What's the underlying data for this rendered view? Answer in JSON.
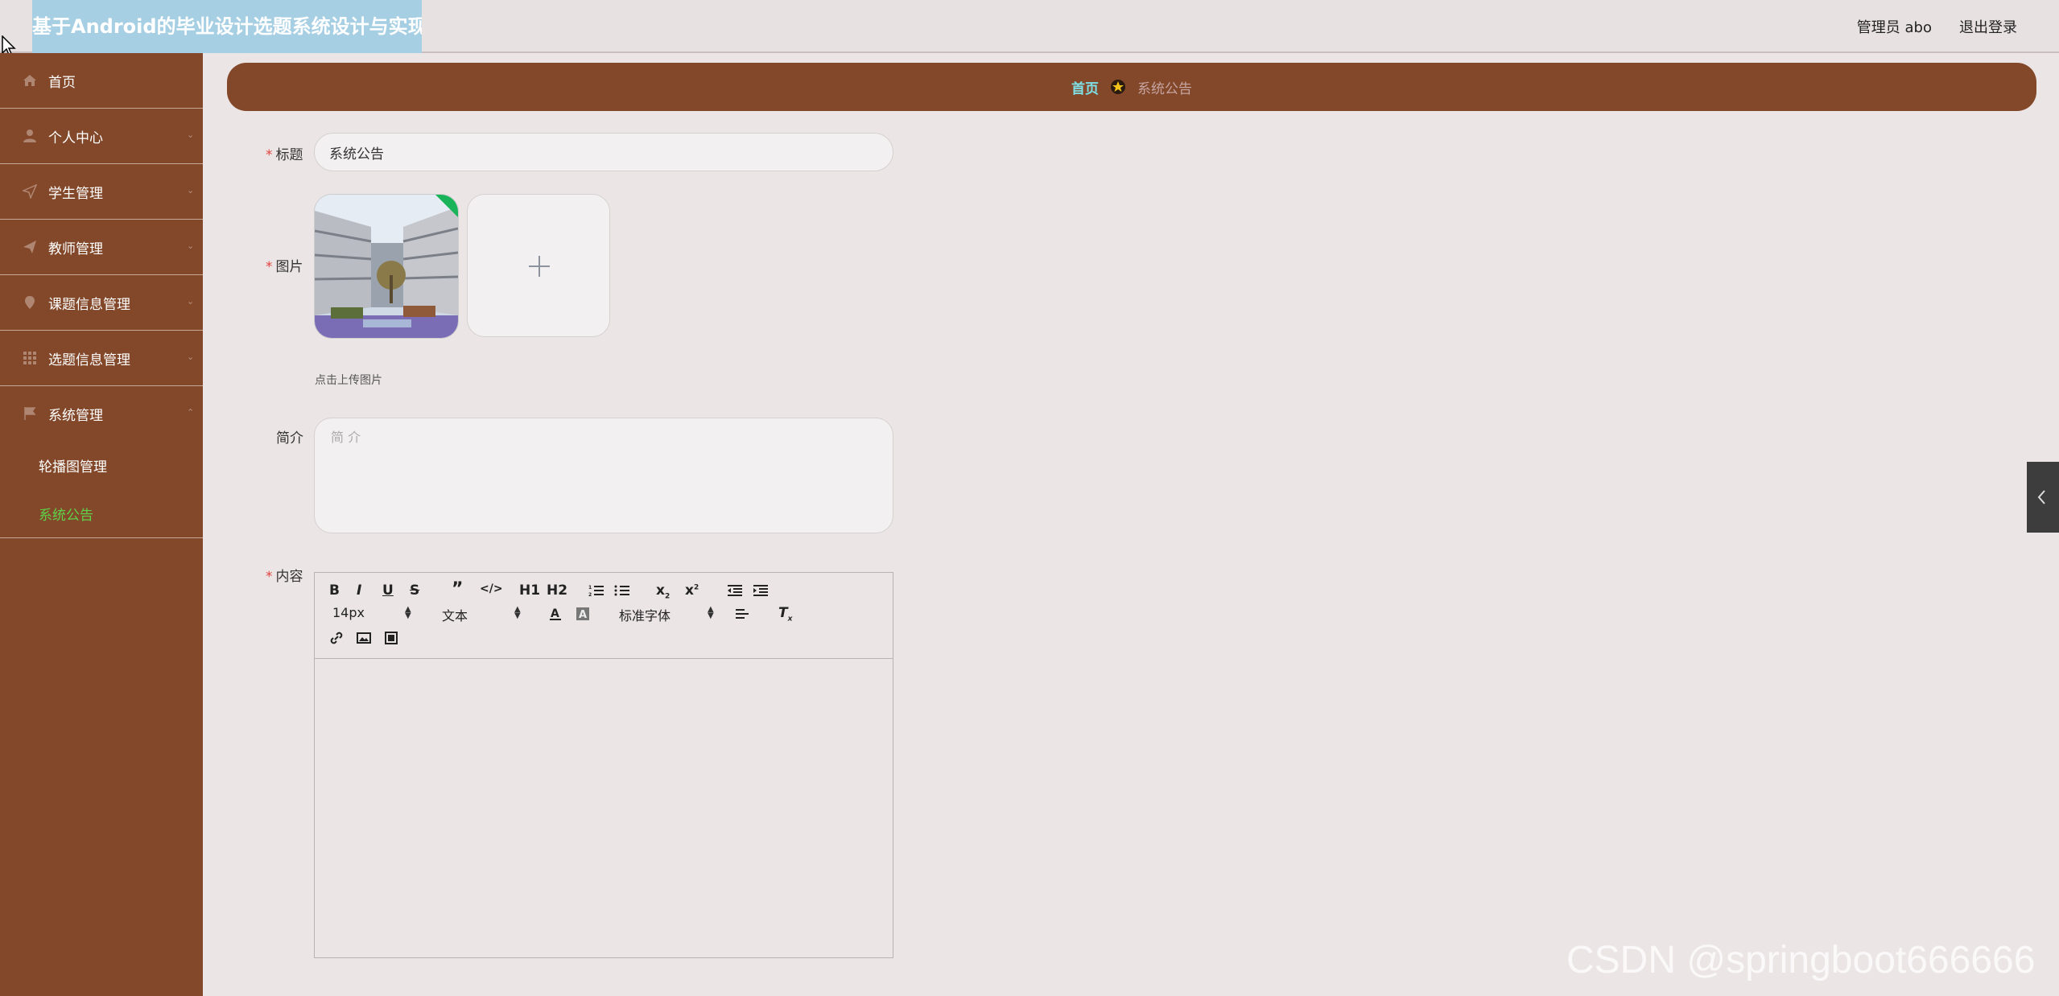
{
  "header": {
    "app_title": "基于Android的毕业设计选题系统设计与实现",
    "admin_label": "管理员 abo",
    "logout_label": "退出登录"
  },
  "sidebar": {
    "items": [
      {
        "label": "首页",
        "icon": "home-icon"
      },
      {
        "label": "个人中心",
        "icon": "user-icon"
      },
      {
        "label": "学生管理",
        "icon": "send-icon"
      },
      {
        "label": "教师管理",
        "icon": "paper-plane-icon"
      },
      {
        "label": "课题信息管理",
        "icon": "location-pin-icon"
      },
      {
        "label": "选题信息管理",
        "icon": "grid-icon"
      },
      {
        "label": "系统管理",
        "icon": "flag-icon"
      }
    ],
    "sub_items": [
      {
        "label": "轮播图管理",
        "active": false
      },
      {
        "label": "系统公告",
        "active": true
      }
    ]
  },
  "breadcrumb": {
    "home": "首页",
    "current": "系统公告"
  },
  "form": {
    "title_label": "标题",
    "title_value": "系统公告",
    "image_label": "图片",
    "upload_hint": "点击上传图片",
    "intro_label": "简介",
    "intro_placeholder": "简 介",
    "content_label": "内容"
  },
  "editor": {
    "buttons": [
      "B",
      "I",
      "U",
      "S",
      "quote",
      "code",
      "H1",
      "H2",
      "ordered-list",
      "bullet-list",
      "subscript",
      "superscript",
      "outdent",
      "indent",
      "color",
      "background",
      "align",
      "clean",
      "link",
      "image",
      "video"
    ],
    "font_size": "14px",
    "header_select": "文本",
    "font_family": "标准字体"
  },
  "watermark": "CSDN @springboot666666",
  "colors": {
    "sidebar_bg": "#83482a",
    "active_green": "#5dd24a",
    "crumb_home": "#7ee0e6",
    "required_red": "#e0443e"
  }
}
